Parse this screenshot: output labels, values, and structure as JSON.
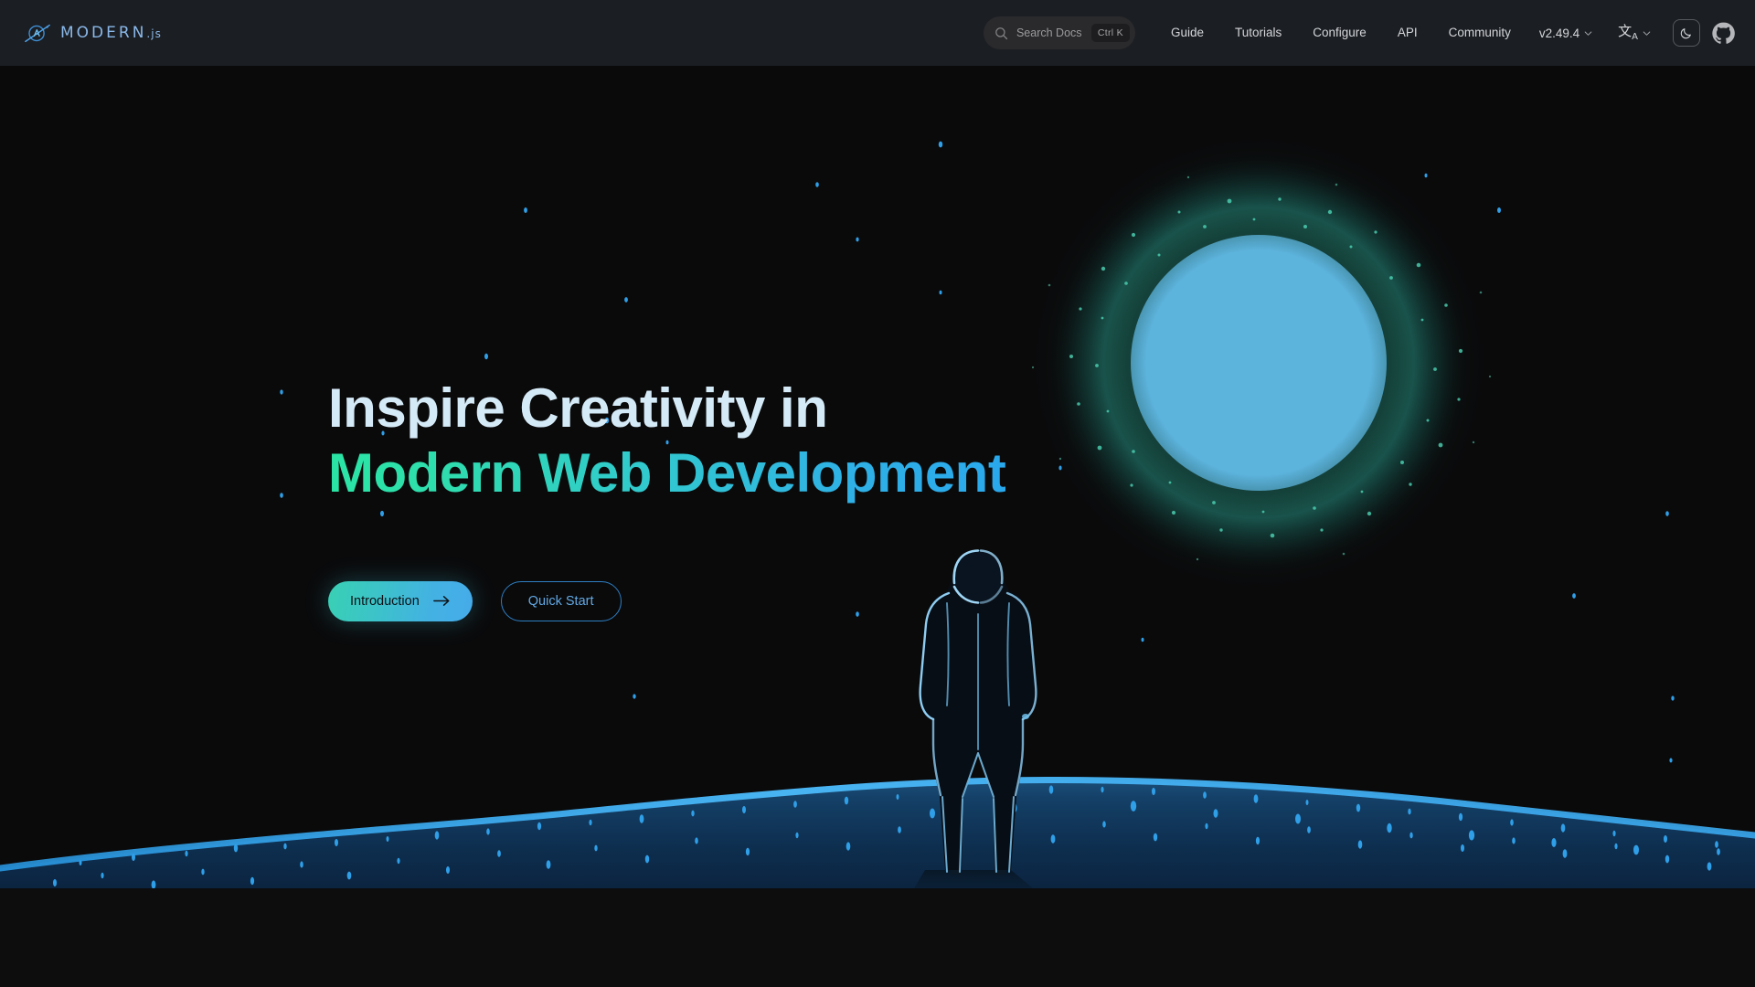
{
  "brand": {
    "name": "MODERN",
    "suffix": ".js",
    "logo_icon": "planet-orbit-icon"
  },
  "navbar": {
    "search": {
      "placeholder": "Search Docs",
      "value": "",
      "shortcut": "Ctrl K",
      "icon": "search-icon"
    },
    "links": [
      {
        "label": "Guide"
      },
      {
        "label": "Tutorials"
      },
      {
        "label": "Configure"
      },
      {
        "label": "API"
      },
      {
        "label": "Community"
      }
    ],
    "version_selector": {
      "label": "v2.49.4",
      "icon": "chevron-down-icon"
    },
    "language_selector": {
      "glyph": "文",
      "sub": "A",
      "icon": "translate-icon"
    },
    "theme_toggle": {
      "icon": "moon-icon",
      "state": "dark"
    },
    "github": {
      "icon": "github-icon"
    }
  },
  "hero": {
    "headline_line1": "Inspire Creativity in",
    "headline_line2": "Modern Web Development",
    "primary_cta": {
      "label": "Introduction",
      "icon": "arrow-right-icon"
    },
    "secondary_cta": {
      "label": "Quick Start"
    }
  },
  "colors": {
    "navbar_bg": "#1b1e23",
    "page_bg": "#0d0d0e",
    "hero_bg": "#0a0a0b",
    "headline_light": "#d5eaf7",
    "gradient_start": "#2ae5a4",
    "gradient_end": "#2aa8ec",
    "moon_fill": "#5cb3dc",
    "halo_green": "#1f6b5e",
    "ground_speckle": "#2a9ce8",
    "outline_border": "#2e7fc4",
    "outline_text": "#62a9e4"
  }
}
